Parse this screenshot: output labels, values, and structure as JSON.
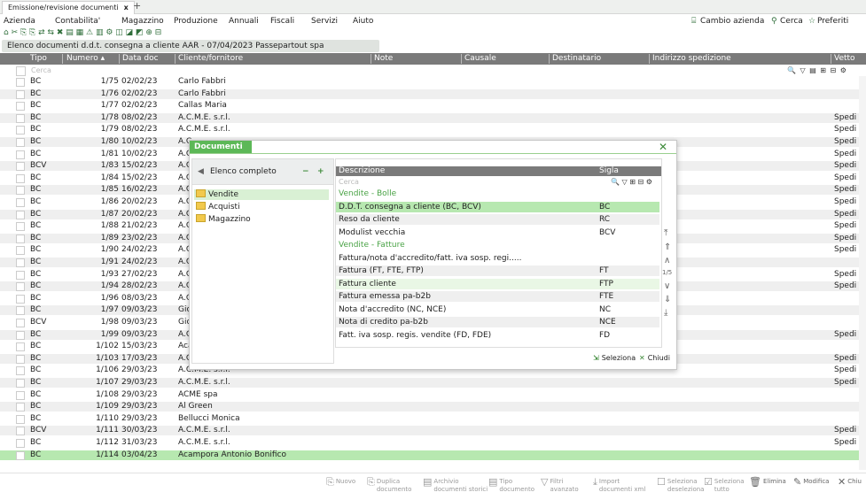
{
  "tab": {
    "label": "Emissione/revisione documenti",
    "close": "x",
    "new": "+"
  },
  "menu": [
    "Azienda",
    "Contabilita'",
    "Magazzino",
    "Produzione",
    "Annuali",
    "Fiscali",
    "Servizi",
    "Aiuto"
  ],
  "top_right": {
    "cambio_azienda": "Cambio azienda",
    "cerca": "Cerca",
    "preferiti": "Preferiti"
  },
  "toolbar_icons": "⌂ ✂ ⎘ ⎘ ⇄ ⇆ ✖ ▤ ▦ ⚠ ▥ ⚙ ◫ ◪ ◩ ⊕ ⊟",
  "title": "Elenco documenti d.d.t. consegna a cliente     AAR - 07/04/2023  Passepartout spa",
  "columns": {
    "tipo": "Tipo",
    "numero": "Numero ▴",
    "data": "Data doc",
    "cliente": "Cliente/fornitore",
    "note": "Note",
    "causale": "Causale",
    "destinatario": "Destinatario",
    "indirizzo": "Indirizzo spedizione",
    "vetto": "Vetto"
  },
  "search_placeholder": "Cerca",
  "search_icons": "🔍 ▽ ▤ ⊞ ⊟ ⚙",
  "rows": [
    {
      "tipo": "BC",
      "num": "1/75",
      "date": "02/02/23",
      "cli": "Carlo Fabbri",
      "vet": ""
    },
    {
      "tipo": "BC",
      "num": "1/76",
      "date": "02/02/23",
      "cli": "Carlo Fabbri",
      "vet": ""
    },
    {
      "tipo": "BC",
      "num": "1/77",
      "date": "02/02/23",
      "cli": "Callas Maria",
      "vet": ""
    },
    {
      "tipo": "BC",
      "num": "1/78",
      "date": "08/02/23",
      "cli": "A.C.M.E. s.r.l.",
      "vet": "Spedi"
    },
    {
      "tipo": "BC",
      "num": "1/79",
      "date": "08/02/23",
      "cli": "A.C.M.E. s.r.l.",
      "vet": "Spedi"
    },
    {
      "tipo": "BC",
      "num": "1/80",
      "date": "10/02/23",
      "cli": "A.C",
      "vet": "Spedi"
    },
    {
      "tipo": "BC",
      "num": "1/81",
      "date": "10/02/23",
      "cli": "A.C",
      "vet": "Spedi"
    },
    {
      "tipo": "BCV",
      "num": "1/83",
      "date": "15/02/23",
      "cli": "A.C",
      "vet": "Spedi"
    },
    {
      "tipo": "BC",
      "num": "1/84",
      "date": "15/02/23",
      "cli": "A.C",
      "vet": "Spedi"
    },
    {
      "tipo": "BC",
      "num": "1/85",
      "date": "16/02/23",
      "cli": "A.C",
      "vet": "Spedi"
    },
    {
      "tipo": "BC",
      "num": "1/86",
      "date": "20/02/23",
      "cli": "A.C",
      "vet": "Spedi"
    },
    {
      "tipo": "BC",
      "num": "1/87",
      "date": "20/02/23",
      "cli": "A.C",
      "vet": "Spedi"
    },
    {
      "tipo": "BC",
      "num": "1/88",
      "date": "21/02/23",
      "cli": "A.C",
      "vet": "Spedi"
    },
    {
      "tipo": "BC",
      "num": "1/89",
      "date": "23/02/23",
      "cli": "A.C",
      "vet": "Spedi"
    },
    {
      "tipo": "BC",
      "num": "1/90",
      "date": "24/02/23",
      "cli": "A.C",
      "vet": "Spedi"
    },
    {
      "tipo": "BC",
      "num": "1/91",
      "date": "24/02/23",
      "cli": "A.C",
      "vet": ""
    },
    {
      "tipo": "BC",
      "num": "1/93",
      "date": "27/02/23",
      "cli": "A.C",
      "vet": "Spedi"
    },
    {
      "tipo": "BC",
      "num": "1/94",
      "date": "28/02/23",
      "cli": "A.C",
      "vet": "Spedi"
    },
    {
      "tipo": "BC",
      "num": "1/96",
      "date": "08/03/23",
      "cli": "A.C",
      "vet": ""
    },
    {
      "tipo": "BC",
      "num": "1/97",
      "date": "09/03/23",
      "cli": "Gio",
      "vet": ""
    },
    {
      "tipo": "BCV",
      "num": "1/98",
      "date": "09/03/23",
      "cli": "Gio",
      "vet": ""
    },
    {
      "tipo": "BC",
      "num": "1/99",
      "date": "09/03/23",
      "cli": "A.C",
      "vet": "Spedi"
    },
    {
      "tipo": "BC",
      "num": "1/102",
      "date": "15/03/23",
      "cli": "Aca",
      "vet": ""
    },
    {
      "tipo": "BC",
      "num": "1/103",
      "date": "17/03/23",
      "cli": "A.C",
      "vet": "Spedi"
    },
    {
      "tipo": "BC",
      "num": "1/106",
      "date": "29/03/23",
      "cli": "A.C.M.E. s.r.l.",
      "vet": "Spedi"
    },
    {
      "tipo": "BC",
      "num": "1/107",
      "date": "29/03/23",
      "cli": "A.C.M.E. s.r.l.",
      "vet": "Spedi"
    },
    {
      "tipo": "BC",
      "num": "1/108",
      "date": "29/03/23",
      "cli": "ACME spa",
      "vet": ""
    },
    {
      "tipo": "BC",
      "num": "1/109",
      "date": "29/03/23",
      "cli": "Al Green",
      "vet": ""
    },
    {
      "tipo": "BC",
      "num": "1/110",
      "date": "29/03/23",
      "cli": "Bellucci Monica",
      "vet": ""
    },
    {
      "tipo": "BCV",
      "num": "1/111",
      "date": "30/03/23",
      "cli": "A.C.M.E. s.r.l.",
      "vet": "Spedi"
    },
    {
      "tipo": "BC",
      "num": "1/112",
      "date": "31/03/23",
      "cli": "A.C.M.E. s.r.l.",
      "vet": "Spedi"
    },
    {
      "tipo": "BC",
      "num": "1/114",
      "date": "03/04/23",
      "cli": "Acampora Antonio Bonifico",
      "vet": ""
    }
  ],
  "dialog": {
    "title": "Documenti",
    "close": "✕",
    "left_header": "Elenco completo",
    "left_back": "◀",
    "left_minus": "−",
    "left_plus": "+",
    "tree": [
      "Vendite",
      "Acquisti",
      "Magazzino"
    ],
    "col_desc": "Descrizione",
    "col_sigla": "Sigla",
    "search_placeholder": "Cerca",
    "search_icons": "🔍 ▽ ⊞ ⊟ ⚙",
    "rows": [
      {
        "desc": "Vendite - Bolle",
        "sigla": ""
      },
      {
        "desc": "D.D.T. consegna a cliente (BC, BCV)",
        "sigla": "BC"
      },
      {
        "desc": "Reso da cliente",
        "sigla": "RC"
      },
      {
        "desc": "Modulist vecchia",
        "sigla": "BCV"
      },
      {
        "desc": "Vendite - Fatture",
        "sigla": ""
      },
      {
        "desc": "Fattura/nota d'accredito/fatt. iva sosp. regi.....",
        "sigla": ""
      },
      {
        "desc": "Fattura (FT, FTE, FTP)",
        "sigla": "FT"
      },
      {
        "desc": "Fattura cliente",
        "sigla": "FTP"
      },
      {
        "desc": "Fattura emessa pa-b2b",
        "sigla": "FTE"
      },
      {
        "desc": "Nota d'accredito (NC, NCE)",
        "sigla": "NC"
      },
      {
        "desc": "Nota di credito pa-b2b",
        "sigla": "NCE"
      },
      {
        "desc": "Fatt. iva sosp. regis. vendite (FD, FDE)",
        "sigla": "FD"
      }
    ],
    "scroll": {
      "first": "⤒",
      "pgup": "⇑",
      "up": "∧",
      "page": "1/5",
      "down": "∨",
      "pgdn": "⇓",
      "last": "⤓"
    },
    "seleziona": "Seleziona",
    "chiudi": "Chiudi"
  },
  "bottom_buttons": [
    {
      "l1": "Nuovo",
      "l2": "",
      "ic": "⎘"
    },
    {
      "l1": "Duplica",
      "l2": "documento",
      "ic": "⎘"
    },
    {
      "l1": "Archivio",
      "l2": "documenti storici",
      "ic": "▤"
    },
    {
      "l1": "Tipo",
      "l2": "documento",
      "ic": "▤"
    },
    {
      "l1": "Filtri",
      "l2": "avanzato",
      "ic": "▽"
    },
    {
      "l1": "Import",
      "l2": "documenti xml",
      "ic": "⤓"
    },
    {
      "l1": "Seleziona",
      "l2": "deseleziona",
      "ic": "☐"
    },
    {
      "l1": "Seleziona",
      "l2": "tutto",
      "ic": "☑"
    },
    {
      "l1": "Elimina",
      "l2": "",
      "ic": "🗑"
    },
    {
      "l1": "Modifica",
      "l2": "",
      "ic": "✎"
    },
    {
      "l1": "Chiu",
      "l2": "",
      "ic": "✕"
    }
  ]
}
